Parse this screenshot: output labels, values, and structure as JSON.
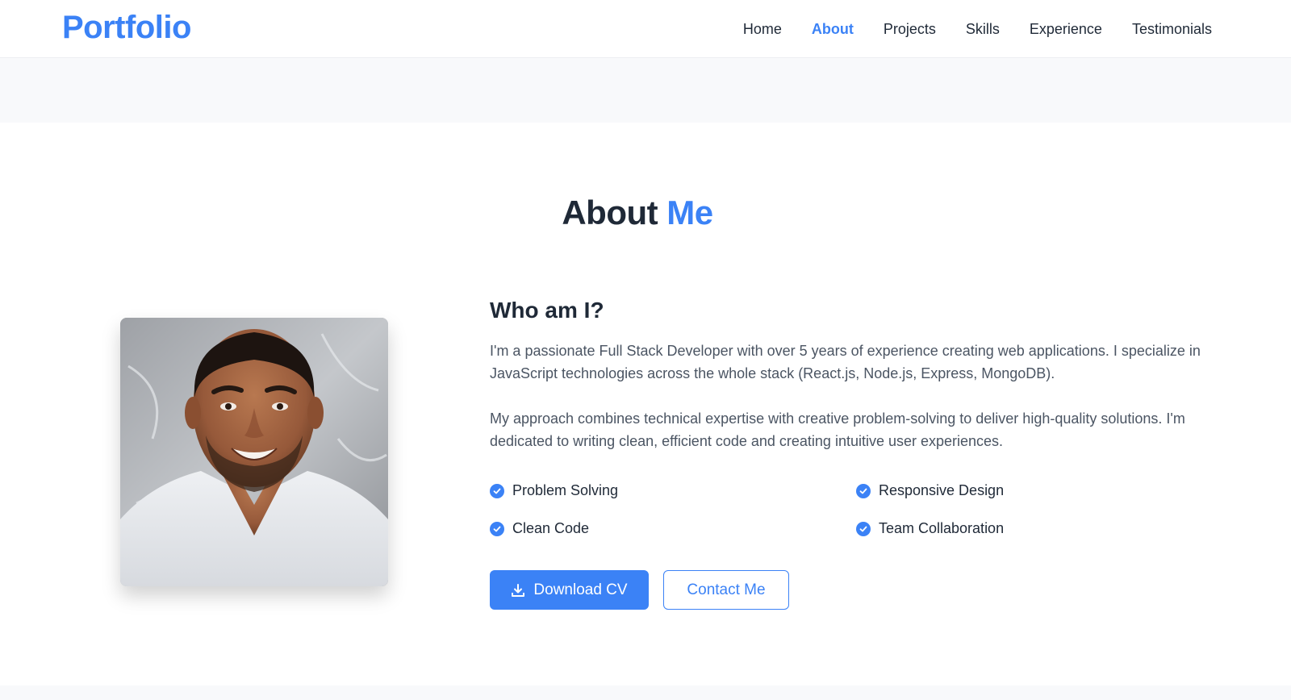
{
  "nav": {
    "logo": "Portfolio",
    "links": [
      {
        "label": "Home"
      },
      {
        "label": "About"
      },
      {
        "label": "Projects"
      },
      {
        "label": "Skills"
      },
      {
        "label": "Experience"
      },
      {
        "label": "Testimonials"
      }
    ],
    "active": "About"
  },
  "about": {
    "title_main": "About",
    "title_accent": "Me",
    "photo_icon": "profile-photo",
    "subtitle": "Who am I?",
    "paragraphs": [
      "I'm a passionate Full Stack Developer with over 5 years of experience creating web applications. I specialize in JavaScript technologies across the whole stack (React.js, Node.js, Express, MongoDB).",
      "My approach combines technical expertise with creative problem-solving to deliver high-quality solutions. I'm dedicated to writing clean, efficient code and creating intuitive user experiences."
    ],
    "skills": [
      "Problem Solving",
      "Responsive Design",
      "Clean Code",
      "Team Collaboration"
    ],
    "buttons": {
      "download_label": "Download CV",
      "download_icon": "download-icon",
      "contact_label": "Contact Me"
    }
  },
  "colors": {
    "accent": "#3b82f6",
    "text": "#1f2937",
    "muted": "#4b5563",
    "band": "#f8f9fb"
  }
}
